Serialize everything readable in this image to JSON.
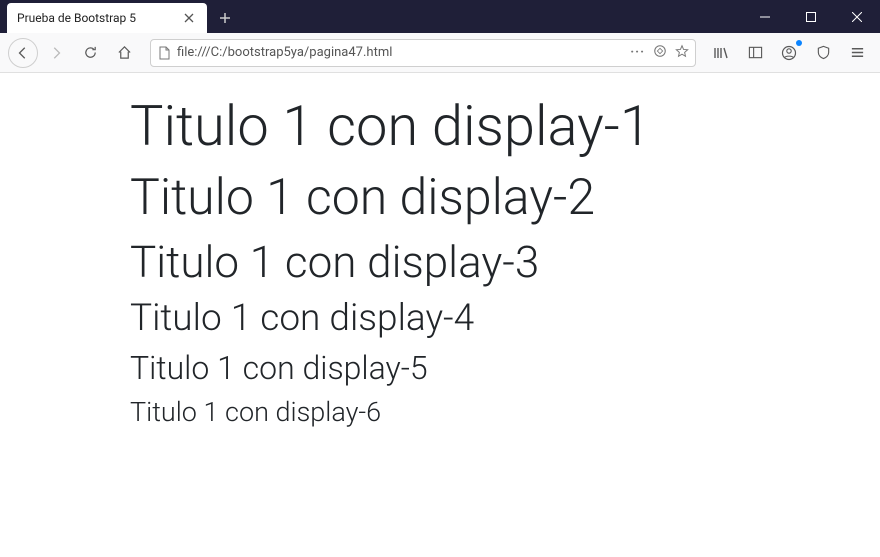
{
  "tab": {
    "title": "Prueba de Bootstrap 5"
  },
  "url": "file:///C:/bootstrap5ya/pagina47.html",
  "headings": {
    "d1": "Titulo 1 con display-1",
    "d2": "Titulo 1 con display-2",
    "d3": "Titulo 1 con display-3",
    "d4": "Titulo 1 con display-4",
    "d5": "Titulo 1 con display-5",
    "d6": "Titulo 1 con display-6"
  }
}
